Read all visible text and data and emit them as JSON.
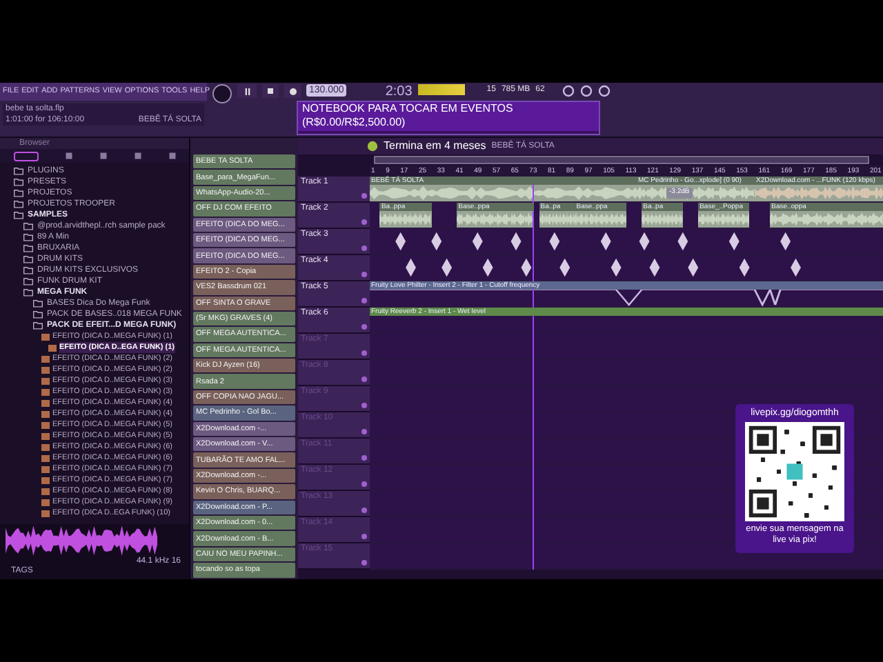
{
  "menu": [
    "FILE",
    "EDIT",
    "ADD",
    "PATTERNS",
    "VIEW",
    "OPTIONS",
    "TOOLS",
    "HELP"
  ],
  "project": {
    "file": "bebe ta solta.flp",
    "position": "1:01:00 for 106:10:00",
    "song": "BEBÊ TÁ SOLTA"
  },
  "transport": {
    "tempo": "130.000",
    "time": "2:03",
    "memory": "785 MB",
    "cpu": "62",
    "polyphony": "15"
  },
  "donation_goal": {
    "title": "NOTEBOOK PARA TOCAR EM EVENTOS",
    "amount": "(R$0.00/R$2,500.00)",
    "level": 0,
    "deadline": "Termina em 4 meses"
  },
  "browser": {
    "title": "Browser",
    "tree": [
      {
        "label": "PLUGINS",
        "expanded": false
      },
      {
        "label": "PRESETS",
        "expanded": false
      },
      {
        "label": "PROJETOS",
        "expanded": false
      },
      {
        "label": "PROJETOS TROOPER",
        "expanded": false
      },
      {
        "label": "SAMPLES",
        "expanded": true,
        "children": [
          {
            "label": "@prod.arvidthepl..rch sample pack",
            "expanded": false
          },
          {
            "label": "89 A Min",
            "expanded": false
          },
          {
            "label": "BRUXARIA",
            "expanded": false
          },
          {
            "label": "DRUM KITS",
            "expanded": false
          },
          {
            "label": "DRUM KITS EXCLUSIVOS",
            "expanded": false
          },
          {
            "label": "FUNK DRUM KIT",
            "expanded": false
          },
          {
            "label": "MEGA FUNK",
            "expanded": true,
            "children": [
              {
                "label": "BASES Dica Do Mega Funk",
                "expanded": false
              },
              {
                "label": "PACK DE BASES..018 MEGA FUNK",
                "expanded": false
              },
              {
                "label": "PACK DE EFEIT...D MEGA FUNK)",
                "expanded": true
              }
            ]
          }
        ]
      }
    ],
    "files": [
      {
        "label": "EFEITO (DICA D..MEGA FUNK) (1)",
        "selected": false
      },
      {
        "label": "EFEITO (DICA D..EGA FUNK) (1)",
        "selected": true
      },
      {
        "label": "EFEITO (DICA D..MEGA FUNK) (2)",
        "selected": false
      },
      {
        "label": "EFEITO (DICA D..MEGA FUNK) (2)",
        "selected": false
      },
      {
        "label": "EFEITO (DICA D..MEGA FUNK) (3)",
        "selected": false
      },
      {
        "label": "EFEITO (DICA D..MEGA FUNK) (3)",
        "selected": false
      },
      {
        "label": "EFEITO (DICA D..MEGA FUNK) (4)",
        "selected": false
      },
      {
        "label": "EFEITO (DICA D..MEGA FUNK) (4)",
        "selected": false
      },
      {
        "label": "EFEITO (DICA D..MEGA FUNK) (5)",
        "selected": false
      },
      {
        "label": "EFEITO (DICA D..MEGA FUNK) (5)",
        "selected": false
      },
      {
        "label": "EFEITO (DICA D..MEGA FUNK) (6)",
        "selected": false
      },
      {
        "label": "EFEITO (DICA D..MEGA FUNK) (6)",
        "selected": false
      },
      {
        "label": "EFEITO (DICA D..MEGA FUNK) (7)",
        "selected": false
      },
      {
        "label": "EFEITO (DICA D..MEGA FUNK) (7)",
        "selected": false
      },
      {
        "label": "EFEITO (DICA D..MEGA FUNK) (8)",
        "selected": false
      },
      {
        "label": "EFEITO (DICA D..MEGA FUNK) (9)",
        "selected": false
      },
      {
        "label": "EFEITO (DICA D..EGA FUNK) (10)",
        "selected": false
      }
    ],
    "preview": {
      "info": "44.1 kHz 16",
      "tags": "TAGS"
    }
  },
  "channels": [
    {
      "name": "BEBE TA SOLTA",
      "color": "#62785f"
    },
    {
      "name": "Base_para_MegaFun...",
      "color": "#62785f"
    },
    {
      "name": "WhatsApp-Audio-20...",
      "color": "#62785f"
    },
    {
      "name": "OFF DJ COM EFEITO",
      "color": "#62785f"
    },
    {
      "name": "EFEITO (DICA DO MEG...",
      "color": "#6d5a80"
    },
    {
      "name": "EFEITO (DICA DO MEG...",
      "color": "#6d5a80"
    },
    {
      "name": "EFEITO (DICA DO MEG...",
      "color": "#6d5a80"
    },
    {
      "name": "EFEITO 2 - Copia",
      "color": "#7a605a"
    },
    {
      "name": "VES2 Bassdrum 021",
      "color": "#7a605a"
    },
    {
      "name": "OFF SINTA O GRAVE",
      "color": "#7a605a"
    },
    {
      "name": "(Sr MKG) GRAVES (4)",
      "color": "#62785f"
    },
    {
      "name": "OFF MEGA AUTENTICA...",
      "color": "#62785f"
    },
    {
      "name": "OFF MEGA AUTENTICA...",
      "color": "#62785f"
    },
    {
      "name": "Kick DJ Ayzen (16)",
      "color": "#7a605a"
    },
    {
      "name": "Rsada 2",
      "color": "#62785f"
    },
    {
      "name": "OFF COPIA NAO JAGU...",
      "color": "#7a605a"
    },
    {
      "name": "MC Pedrinho - Gol Bo...",
      "color": "#5a6480"
    },
    {
      "name": "X2Download.com -...",
      "color": "#6d5a80"
    },
    {
      "name": "X2Download.com - V...",
      "color": "#6d5a80"
    },
    {
      "name": "TUBARÃO TE AMO FAL...",
      "color": "#7a605a"
    },
    {
      "name": "X2Download.com -...",
      "color": "#7a605a"
    },
    {
      "name": "Kevin O Chris, BUARQ...",
      "color": "#7a605a"
    },
    {
      "name": "X2Download.com - P...",
      "color": "#5a6480"
    },
    {
      "name": "X2Download.com - 0...",
      "color": "#62785f"
    },
    {
      "name": "X2Download.com - B...",
      "color": "#62785f"
    },
    {
      "name": "CAIU NO MEU PAPINH...",
      "color": "#62785f"
    },
    {
      "name": "tocando so as topa",
      "color": "#62785f"
    }
  ],
  "playlist": {
    "title": "BEBÊ TÁ SOLTA",
    "ruler": [
      "1",
      "9",
      "17",
      "25",
      "33",
      "41",
      "49",
      "57",
      "65",
      "73",
      "81",
      "89",
      "97",
      "105",
      "113",
      "121",
      "129",
      "137",
      "145",
      "153",
      "161",
      "169",
      "177",
      "185",
      "193",
      "201"
    ],
    "volume_tip": "-3.2dB",
    "tracks": [
      {
        "name": "Track 1",
        "active": true,
        "clips": [
          "BEBÊ TÁ SOLTA",
          "MC Pedrinho - Go...xplode] (0 90)",
          "X2Download.com - ...FUNK (120 kbps)"
        ]
      },
      {
        "name": "Track 2",
        "active": true,
        "clips": [
          "Ba..ppa",
          "Base..ppa",
          "Ba..pa",
          "Base..ppa",
          "Ba..pa",
          "Base_..Poppa",
          "Base..oppa"
        ]
      },
      {
        "name": "Track 3",
        "active": true
      },
      {
        "name": "Track 4",
        "active": true
      },
      {
        "name": "Track 5",
        "active": true,
        "clips": [
          "Fruity Love Philter - Insert 2 - Filter 1 - Cutoff frequency"
        ]
      },
      {
        "name": "Track 6",
        "active": true,
        "clips": [
          "Fruity Reeverb 2 - Insert 1 - Wet level"
        ]
      },
      {
        "name": "Track 7",
        "active": false
      },
      {
        "name": "Track 8",
        "active": false
      },
      {
        "name": "Track 9",
        "active": false
      },
      {
        "name": "Track 10",
        "active": false
      },
      {
        "name": "Track 11",
        "active": false
      },
      {
        "name": "Track 12",
        "active": false
      },
      {
        "name": "Track 13",
        "active": false
      },
      {
        "name": "Track 14",
        "active": false
      },
      {
        "name": "Track 15",
        "active": false
      }
    ]
  },
  "livepix": {
    "url": "livepix.gg/diogomthh",
    "message": "envie sua mensagem na live via pix!"
  }
}
